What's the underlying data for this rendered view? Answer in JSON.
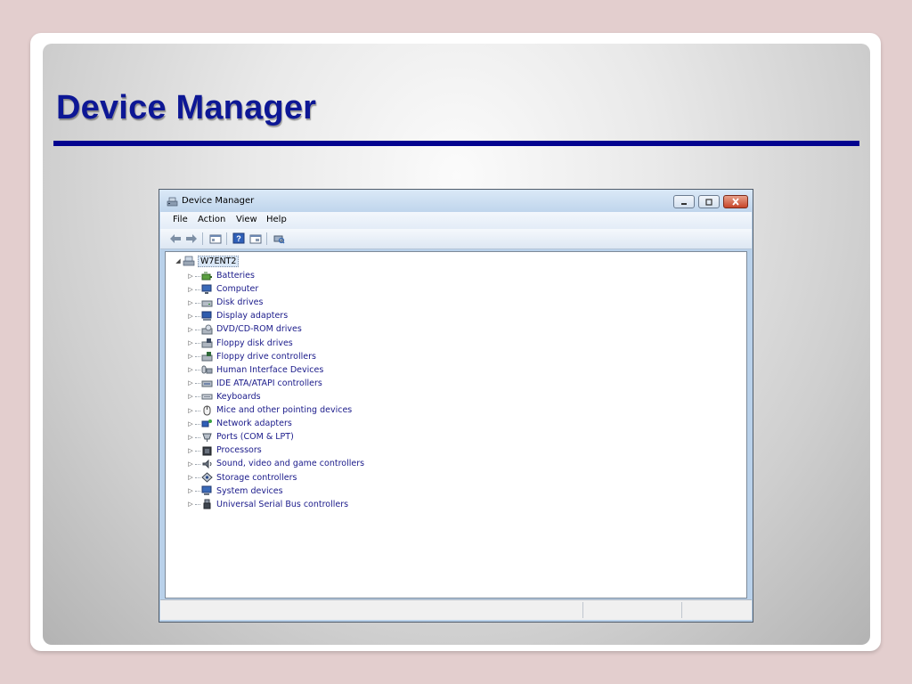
{
  "slide": {
    "title": "Device Manager"
  },
  "window": {
    "title": "Device Manager",
    "controls": [
      "minimize-icon",
      "maximize-icon",
      "close-icon"
    ]
  },
  "menu": [
    "File",
    "Action",
    "View",
    "Help"
  ],
  "toolbar": [
    "back-arrow-icon",
    "forward-arrow-icon",
    "show-hide-console-tree-icon",
    "help-icon",
    "properties-icon",
    "scan-hardware-icon"
  ],
  "tree": {
    "root": "W7ENT2",
    "items": [
      {
        "label": "Batteries",
        "icon": "battery-icon"
      },
      {
        "label": "Computer",
        "icon": "computer-icon"
      },
      {
        "label": "Disk drives",
        "icon": "disk-drive-icon"
      },
      {
        "label": "Display adapters",
        "icon": "display-adapter-icon"
      },
      {
        "label": "DVD/CD-ROM drives",
        "icon": "dvd-drive-icon"
      },
      {
        "label": "Floppy disk drives",
        "icon": "floppy-drive-icon"
      },
      {
        "label": "Floppy drive controllers",
        "icon": "floppy-controller-icon"
      },
      {
        "label": "Human Interface Devices",
        "icon": "hid-icon"
      },
      {
        "label": "IDE ATA/ATAPI controllers",
        "icon": "ide-controller-icon"
      },
      {
        "label": "Keyboards",
        "icon": "keyboard-icon"
      },
      {
        "label": "Mice and other pointing devices",
        "icon": "mouse-icon"
      },
      {
        "label": "Network adapters",
        "icon": "network-adapter-icon"
      },
      {
        "label": "Ports (COM & LPT)",
        "icon": "port-icon"
      },
      {
        "label": "Processors",
        "icon": "processor-icon"
      },
      {
        "label": "Sound, video and game controllers",
        "icon": "sound-icon"
      },
      {
        "label": "Storage controllers",
        "icon": "storage-controller-icon"
      },
      {
        "label": "System devices",
        "icon": "system-device-icon"
      },
      {
        "label": "Universal Serial Bus controllers",
        "icon": "usb-icon"
      }
    ]
  },
  "colors": {
    "title": "#0d1795",
    "title_rule": "#03038f",
    "tree_label": "#1a1a8a"
  }
}
